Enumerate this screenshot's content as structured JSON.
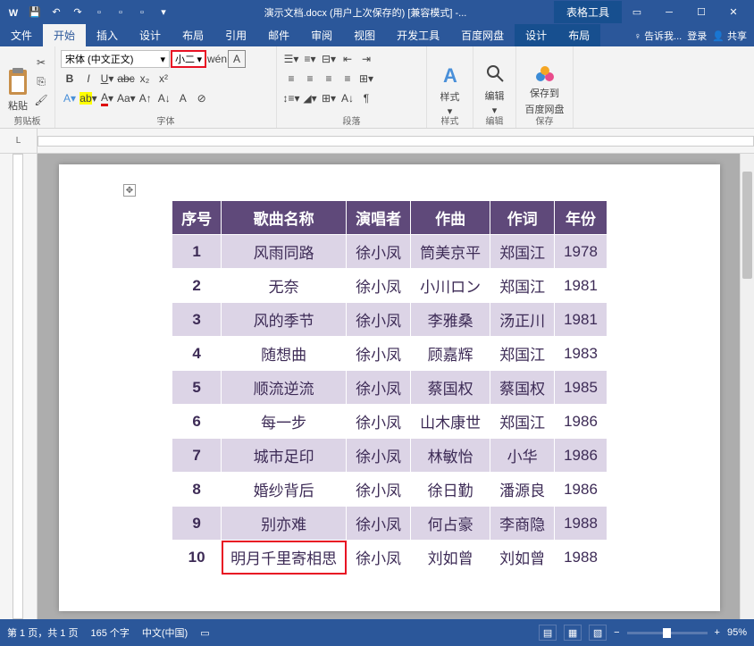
{
  "title": "演示文档.docx (用户上次保存的) [兼容模式] -...",
  "table_tools": "表格工具",
  "tabs": {
    "file": "文件",
    "home": "开始",
    "insert": "插入",
    "design": "设计",
    "layout": "布局",
    "references": "引用",
    "mailings": "邮件",
    "review": "审阅",
    "view": "视图",
    "developer": "开发工具",
    "baidu": "百度网盘",
    "tdesign": "设计",
    "tlayout": "布局",
    "tell": "告诉我...",
    "login": "登录",
    "share": "共享"
  },
  "groups": {
    "clipboard": "剪贴板",
    "font": "字体",
    "paragraph": "段落",
    "styles": "样式",
    "editing": "编辑",
    "save": "保存"
  },
  "font": {
    "name": "宋体 (中文正文)",
    "size": "小二"
  },
  "clipboard": {
    "paste": "粘贴"
  },
  "styles": {
    "button": "样式"
  },
  "editing": {
    "button": "编辑"
  },
  "baidu_save": {
    "line1": "保存到",
    "line2": "百度网盘"
  },
  "table": {
    "headers": [
      "序号",
      "歌曲名称",
      "演唱者",
      "作曲",
      "作词",
      "年份"
    ],
    "rows": [
      [
        "1",
        "风雨同路",
        "徐小凤",
        "筒美京平",
        "郑国江",
        "1978"
      ],
      [
        "2",
        "无奈",
        "徐小凤",
        "小川ロン",
        "郑国江",
        "1981"
      ],
      [
        "3",
        "风的季节",
        "徐小凤",
        "李雅桑",
        "汤正川",
        "1981"
      ],
      [
        "4",
        "随想曲",
        "徐小凤",
        "顾嘉辉",
        "郑国江",
        "1983"
      ],
      [
        "5",
        "顺流逆流",
        "徐小凤",
        "蔡国权",
        "蔡国权",
        "1985"
      ],
      [
        "6",
        "每一步",
        "徐小凤",
        "山木康世",
        "郑国江",
        "1986"
      ],
      [
        "7",
        "城市足印",
        "徐小凤",
        "林敏怡",
        "小华",
        "1986"
      ],
      [
        "8",
        "婚纱背后",
        "徐小凤",
        "徐日勤",
        "潘源良",
        "1986"
      ],
      [
        "9",
        "别亦难",
        "徐小凤",
        "何占豪",
        "李商隐",
        "1988"
      ],
      [
        "10",
        "明月千里寄相思",
        "徐小凤",
        "刘如曾",
        "刘如曾",
        "1988"
      ]
    ]
  },
  "status": {
    "page": "第 1 页，共 1 页",
    "words": "165 个字",
    "lang": "中文(中国)",
    "zoom": "95%"
  }
}
